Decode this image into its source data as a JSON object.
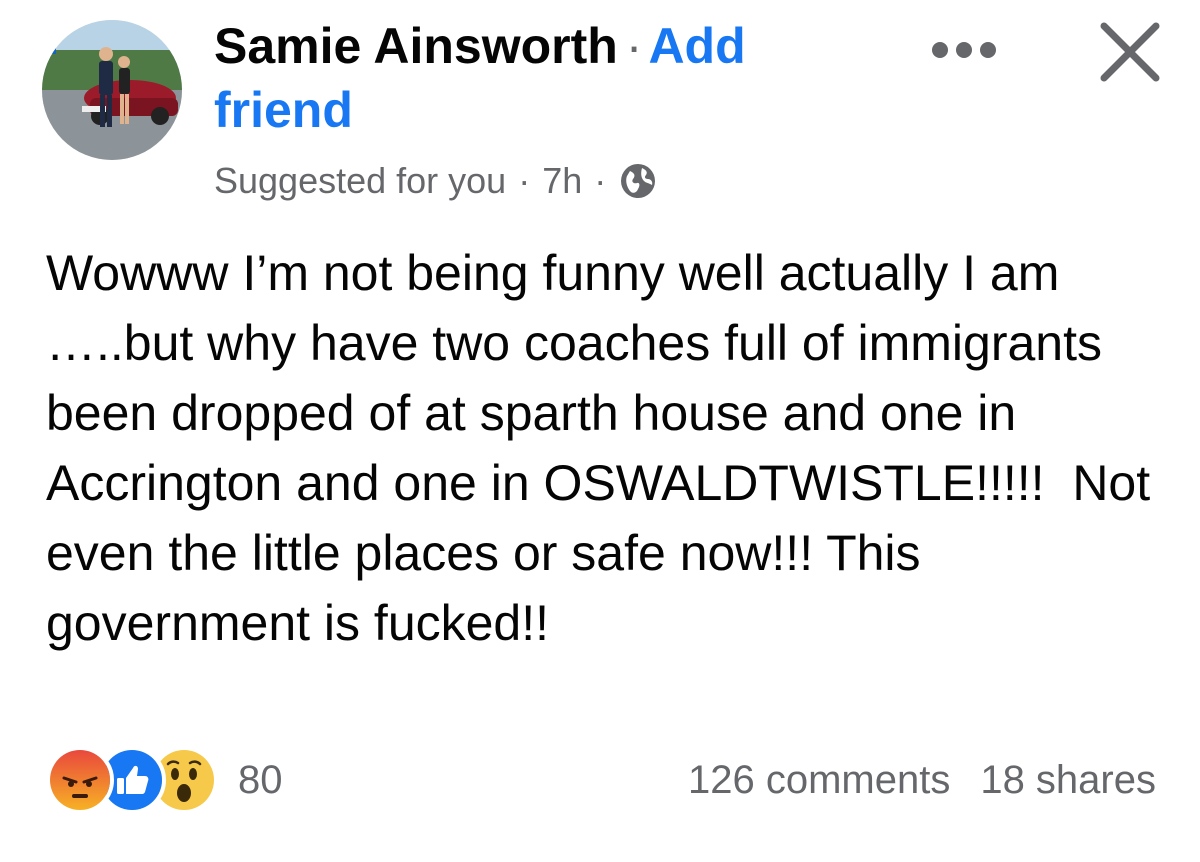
{
  "post": {
    "author_name": "Samie Ainsworth",
    "separator": "·",
    "add_friend_label": "Add friend",
    "suggestion_label": "Suggested for you",
    "time_ago": "7h",
    "privacy_icon": "globe-icon",
    "more_icon": "more-horizontal-icon",
    "close_icon": "close-icon",
    "text": "Wowww I’m not being funny well actually I am …..but why have two coaches full of immigrants been dropped of at sparth house and one in Accrington and one in OSWALDTWISTLE!!!!!  Not even the little places or safe now!!! This government is fucked!!",
    "reactions": {
      "icons": [
        "angry-reaction-icon",
        "like-reaction-icon",
        "wow-reaction-icon"
      ],
      "count": "80"
    },
    "comments_label": "126 comments",
    "shares_label": "18 shares"
  },
  "colors": {
    "link_blue": "#1877f2",
    "secondary_text": "#65676b",
    "primary_text": "#050505"
  }
}
